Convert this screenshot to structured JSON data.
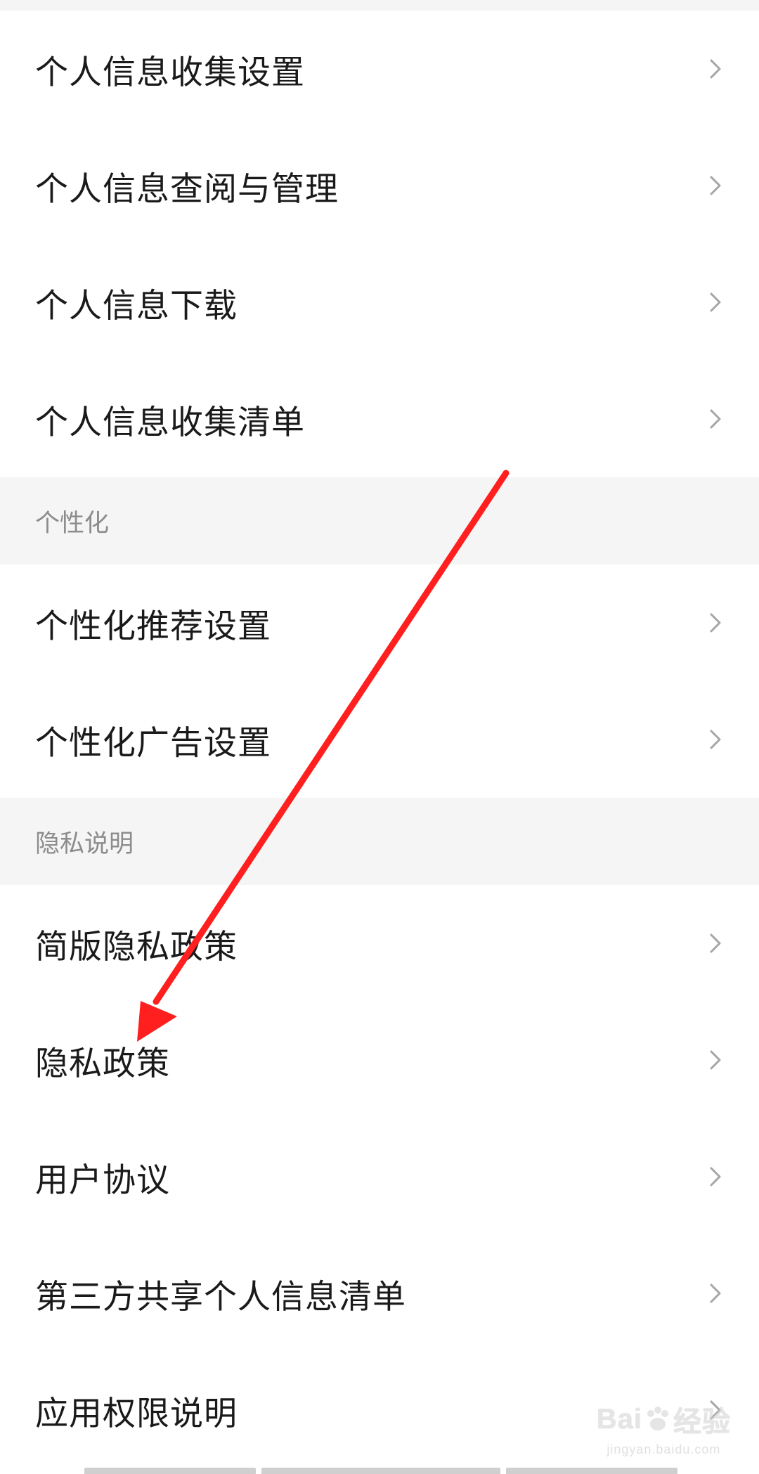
{
  "sections": [
    {
      "header": "",
      "items": [
        {
          "label": "个人信息收集设置"
        },
        {
          "label": "个人信息查阅与管理"
        },
        {
          "label": "个人信息下载"
        },
        {
          "label": "个人信息收集清单"
        }
      ]
    },
    {
      "header": "个性化",
      "items": [
        {
          "label": "个性化推荐设置"
        },
        {
          "label": "个性化广告设置"
        }
      ]
    },
    {
      "header": "隐私说明",
      "items": [
        {
          "label": "简版隐私政策"
        },
        {
          "label": "隐私政策"
        },
        {
          "label": "用户协议"
        },
        {
          "label": "第三方共享个人信息清单"
        },
        {
          "label": "应用权限说明"
        }
      ]
    }
  ],
  "icons": {
    "row_chevron": "chevron-right-icon"
  },
  "colors": {
    "annotation_arrow": "#ff1f1f",
    "section_background": "#f5f5f5",
    "chevron": "#a6a6a6"
  },
  "watermark": {
    "logo_text": "Bai",
    "logo_text_2": "经验",
    "sub_text": "jingyan.baidu.com"
  }
}
